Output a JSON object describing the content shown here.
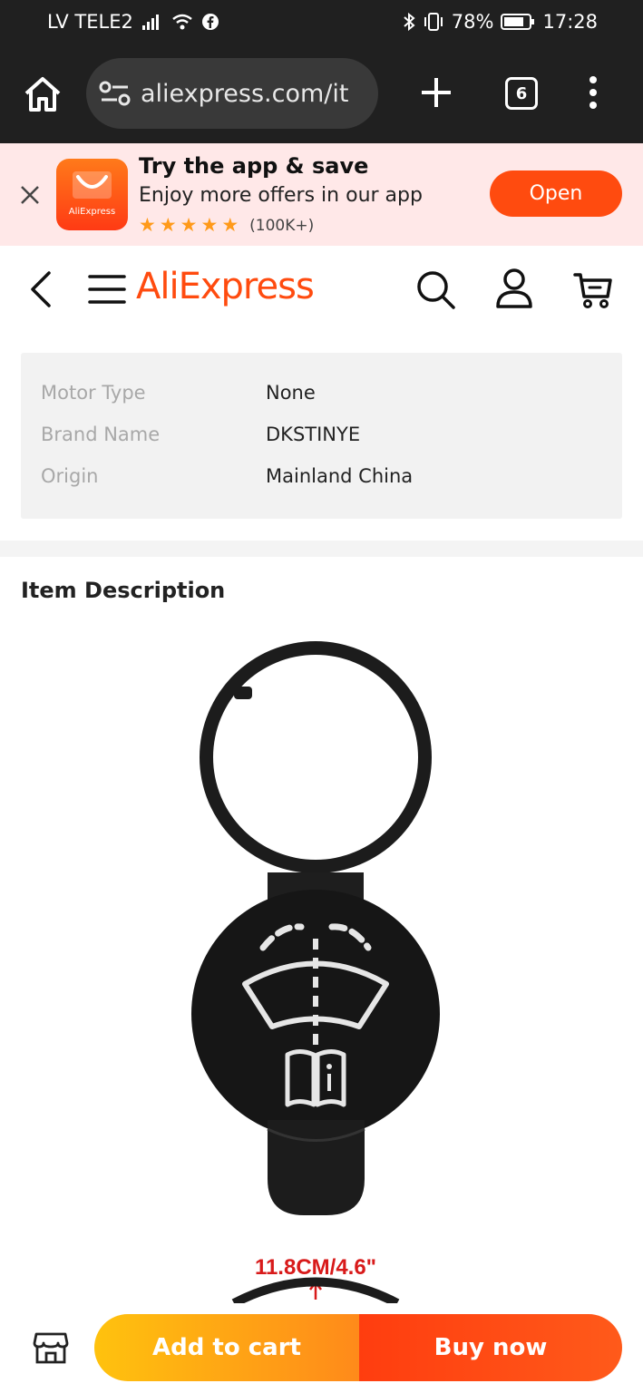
{
  "status_bar": {
    "carrier": "LV TELE2",
    "battery": "78%",
    "time": "17:28"
  },
  "browser": {
    "url": "aliexpress.com/it",
    "tab_count": "6"
  },
  "app_banner": {
    "title": "Try the app & save",
    "subtitle": "Enjoy more offers in our app",
    "logo_text": "AliExpress",
    "rating_stars": 5,
    "rating_count": "(100K+)",
    "open_label": "Open"
  },
  "header": {
    "brand": "AliExpress"
  },
  "specs": [
    {
      "key": "Motor Type",
      "value": "None"
    },
    {
      "key": "Brand Name",
      "value": "DKSTINYE"
    },
    {
      "key": "Origin",
      "value": "Mainland China"
    }
  ],
  "description": {
    "title": "Item Description",
    "dimension_label": "11.8CM/4.6\""
  },
  "actions": {
    "add_to_cart": "Add to cart",
    "buy_now": "Buy now"
  },
  "colors": {
    "brand": "#ff4b0f",
    "dark_bar": "#202020",
    "banner_bg": "#ffe8e8"
  }
}
